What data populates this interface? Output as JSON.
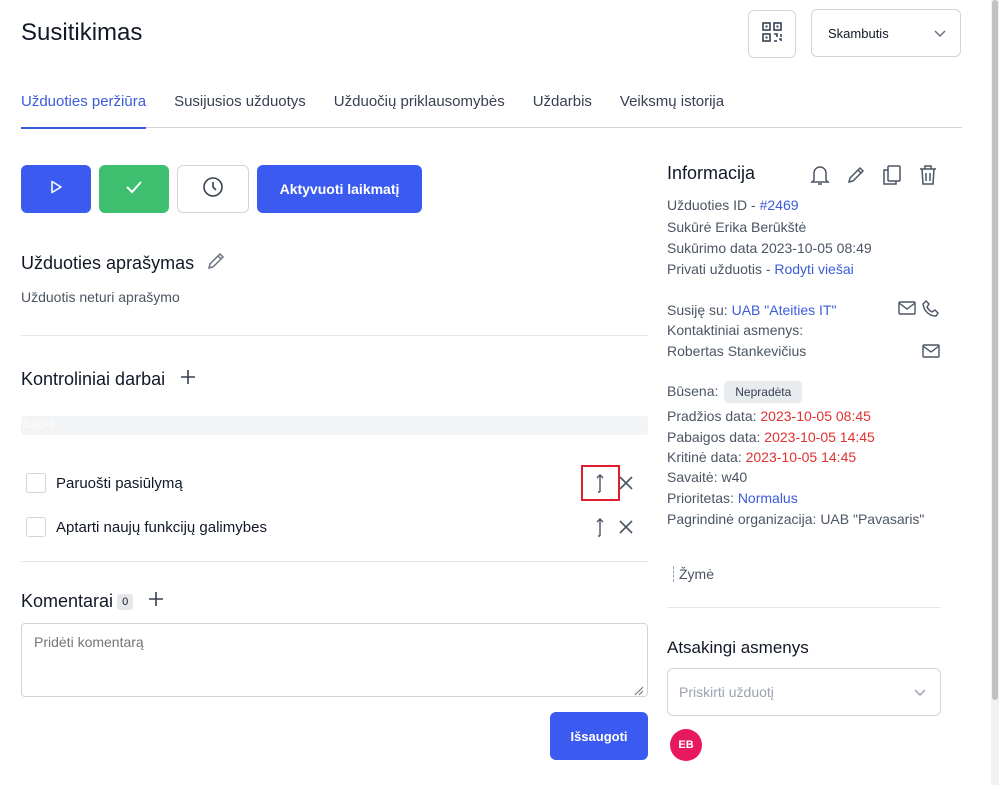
{
  "header": {
    "title": "Susitikimas",
    "qr_icon": "qr-code-icon",
    "type_select": {
      "value": "Skambutis",
      "icon": "chevron-down-icon"
    }
  },
  "tabs": [
    {
      "label": "Užduoties peržiūra",
      "active": true
    },
    {
      "label": "Susijusios užduotys",
      "active": false
    },
    {
      "label": "Užduočių priklausomybės",
      "active": false
    },
    {
      "label": "Uždarbis",
      "active": false
    },
    {
      "label": "Veiksmų istorija",
      "active": false
    }
  ],
  "actions": {
    "play_icon": "play-icon",
    "check_icon": "check-icon",
    "clock_icon": "clock-icon",
    "timer_label": "Aktyvuoti laikmatį"
  },
  "description": {
    "title": "Užduoties aprašymas",
    "edit_icon": "pencil-icon",
    "text": "Užduotis neturi aprašymo"
  },
  "checklist": {
    "title": "Kontroliniai darbai",
    "add_icon": "plus-icon",
    "progress_label": "0.00%",
    "progress": 0,
    "items": [
      {
        "label": "Paruošti pasiūlymą",
        "checked": false
      },
      {
        "label": "Aptarti naujų funkcijų galimybes",
        "checked": false
      }
    ]
  },
  "comments": {
    "title": "Komentarai",
    "count": "0",
    "add_icon": "plus-icon",
    "placeholder": "Pridėti komentarą",
    "save_label": "Išsaugoti"
  },
  "info": {
    "title": "Informacija",
    "icons": [
      "bell-icon",
      "pencil-icon",
      "copy-icon",
      "trash-icon"
    ],
    "task_id_label": "Užduoties ID - ",
    "task_id": "#2469",
    "created_by": "Sukūrė Erika Berūkštė",
    "created_date": "Sukūrimo data 2023-10-05 08:49",
    "private_label": "Privati užduotis - ",
    "private_link": "Rodyti viešai",
    "related_label": "Susiję su: ",
    "related_link": "UAB \"Ateities IT\"",
    "contacts_label": "Kontaktiniai asmenys:",
    "contact_name": "Robertas Stankevičius",
    "status_label": "Būsena: ",
    "status": "Nepradėta",
    "start_label": "Pradžios data: ",
    "start_date": "2023-10-05 08:45",
    "end_label": "Pabaigos data: ",
    "end_date": "2023-10-05 14:45",
    "critical_label": "Kritinė data: ",
    "critical_date": "2023-10-05 14:45",
    "week": "Savaitė: w40",
    "priority_label": "Prioritetas: ",
    "priority": "Normalus",
    "org": "Pagrindinė organizacija: UAB \"Pavasaris\"",
    "tag": "Žymė"
  },
  "responsible": {
    "title": "Atsakingi asmenys",
    "placeholder": "Priskirti užduotį",
    "avatar_initials": "EB",
    "avatar_color": "#e8185f"
  },
  "colors": {
    "accent": "#3b5bf0",
    "success": "#3dbf6f",
    "danger": "#e03131",
    "highlight": "#e11d2e"
  }
}
